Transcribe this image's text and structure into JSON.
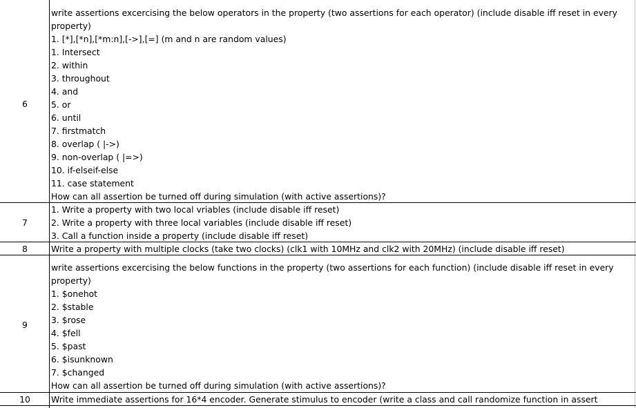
{
  "rows": [
    {
      "number": "6",
      "lines": [
        "write assertions excercising the below operators in the property (two assertions for each operator) (include disable iff reset in every",
        "property)",
        "1. [*],[*n],[*m:n],[->],[=]    (m and n are random values)",
        "1. Intersect",
        "2. within",
        "3. throughout",
        "4. and",
        "5. or",
        "6. until",
        "7. firstmatch",
        "8. overlap ( |->)",
        "9. non-overlap ( |=>)",
        "10. if-elseif-else",
        "11. case statement",
        "How can all assertion be turned off during simulation (with active assertions)?"
      ]
    },
    {
      "number": "7",
      "lines": [
        "1. Write a property with two local vriables (include disable iff reset)",
        "2. Write a property with three local variables (include disable iff reset)",
        "3. Call a function inside a property (include disable iff reset)"
      ]
    },
    {
      "number": "8",
      "lines": [
        "Write a property with multiple clocks (take two clocks) (clk1 with 10MHz and clk2 with 20MHz) (include disable iff reset)"
      ]
    },
    {
      "number": "9",
      "lines": [
        "write assertions excercising the below functions in the property (two assertions for each function) (include disable iff reset in every",
        "property)",
        "1. $onehot",
        "2. $stable",
        "3. $rose",
        "4. $fell",
        "5. $past",
        "6. $isunknown",
        "7. $changed",
        "How can all assertion be turned off during simulation (with active assertions)?"
      ]
    },
    {
      "number": "10",
      "lines": [
        "Write immediate assertions for 16*4 encoder. Generate stimulus to encoder (write a class and call randomize function in assert"
      ]
    }
  ]
}
